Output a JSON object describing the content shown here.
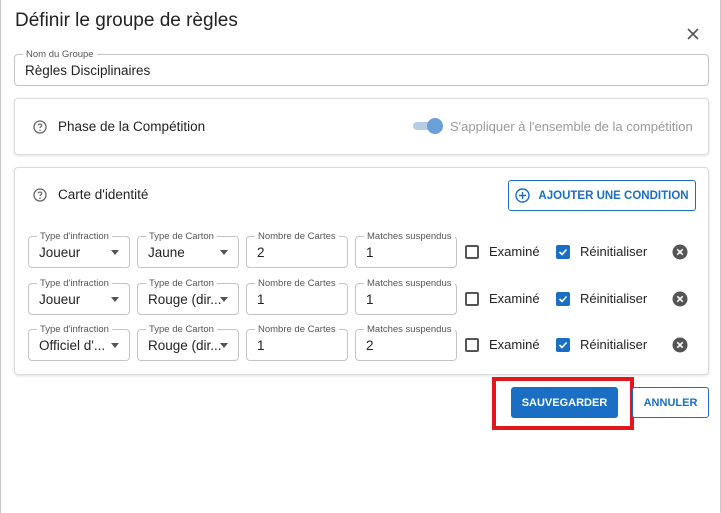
{
  "dialog": {
    "title": "Définir le groupe de règles",
    "close_icon": "close-icon"
  },
  "group_name": {
    "label": "Nom du Groupe",
    "value": "Règles Disciplinaires"
  },
  "phase": {
    "label": "Phase de la Compétition",
    "toggle_label": "S'appliquer à l'ensemble de la compétition",
    "toggle_on": true
  },
  "id_card": {
    "label": "Carte d'identité",
    "add_button": "AJOUTER UNE CONDITION",
    "field_labels": {
      "infraction": "Type d'infraction",
      "card_type": "Type de Carton",
      "card_count": "Nombre de Cartes",
      "suspended": "Matches suspendus"
    },
    "checkbox_labels": {
      "examined": "Examiné",
      "reset": "Réinitialiser"
    },
    "rows": [
      {
        "infraction": "Joueur",
        "card_type": "Jaune",
        "card_count": "2",
        "suspended": "1",
        "examined": false,
        "reset": true
      },
      {
        "infraction": "Joueur",
        "card_type": "Rouge (dir...",
        "card_count": "1",
        "suspended": "1",
        "examined": false,
        "reset": true
      },
      {
        "infraction": "Officiel d'...",
        "card_type": "Rouge (dir...",
        "card_count": "1",
        "suspended": "2",
        "examined": false,
        "reset": true
      }
    ]
  },
  "actions": {
    "save": "SAUVEGARDER",
    "cancel": "ANNULER"
  },
  "colors": {
    "accent": "#1a6fc4",
    "highlight": "#e3161c"
  }
}
